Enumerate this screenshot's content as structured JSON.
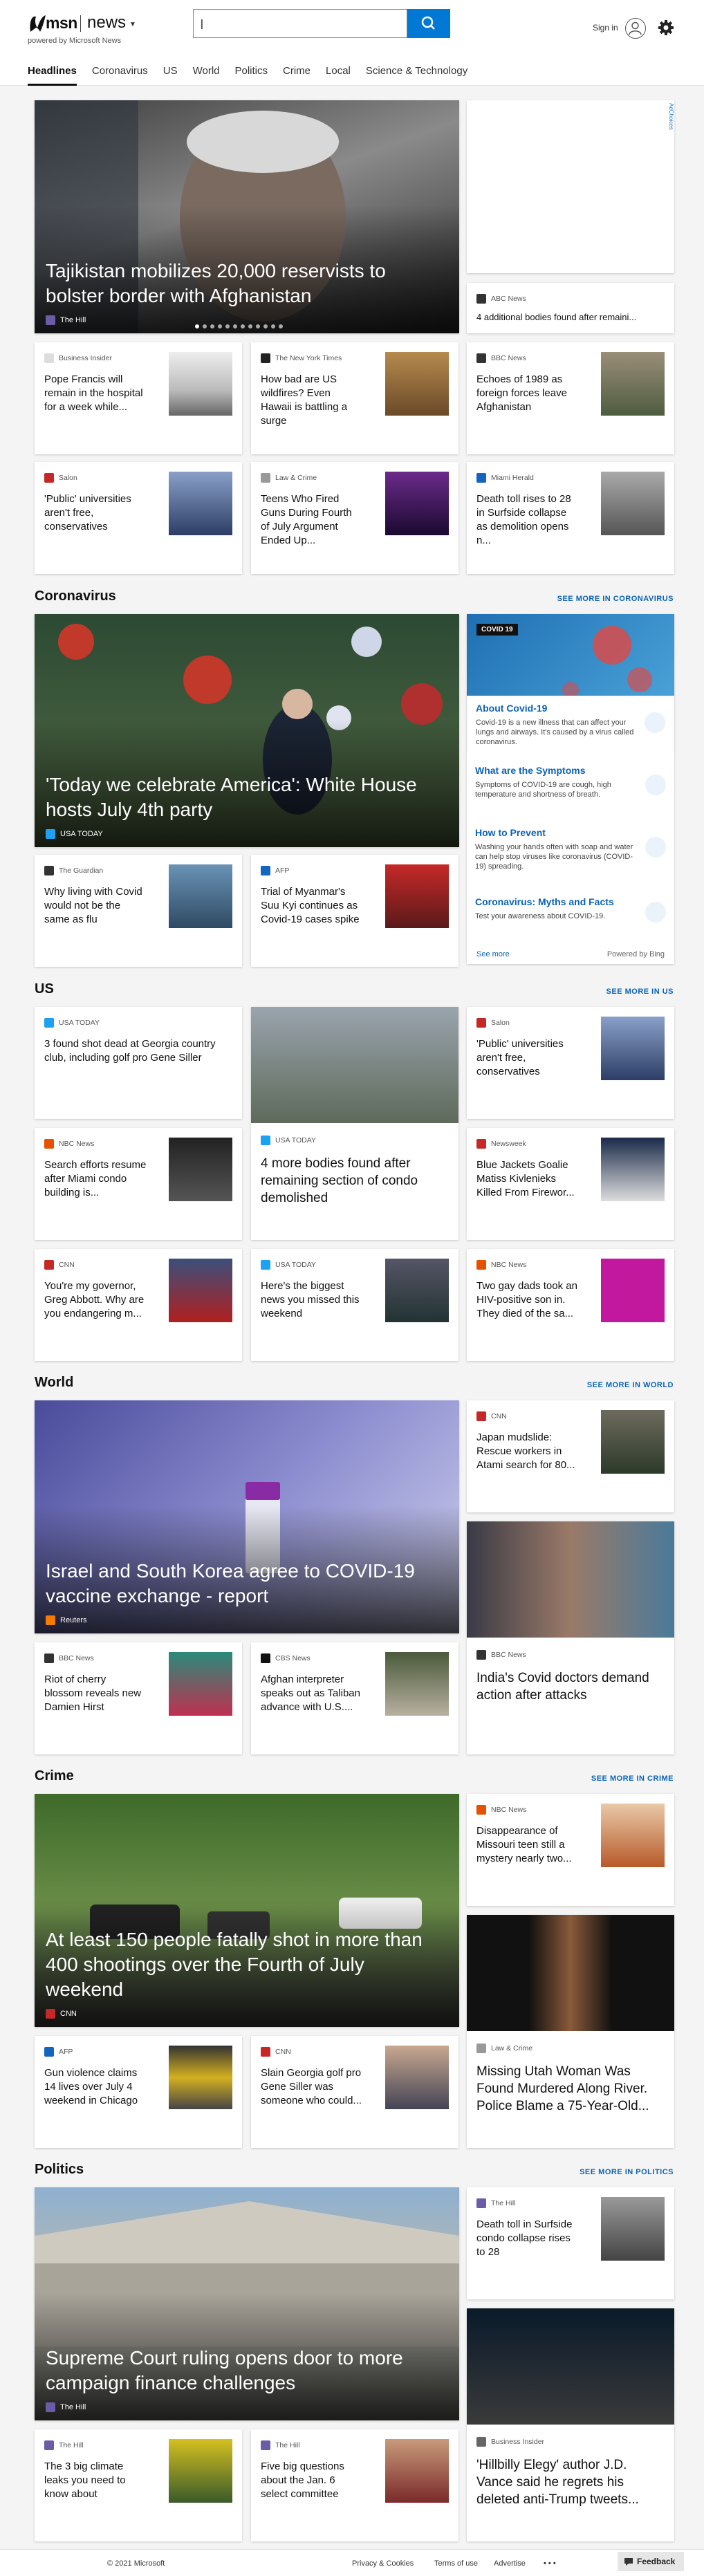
{
  "header": {
    "brand": "msn",
    "section": "news",
    "powered_by": "powered by Microsoft News",
    "search_value": "|",
    "signin": "Sign in"
  },
  "nav": [
    "Headlines",
    "Coronavirus",
    "US",
    "World",
    "Politics",
    "Crime",
    "Local",
    "Science & Technology"
  ],
  "headlines": {
    "hero": {
      "title": "Tajikistan mobilizes 20,000 reservists to bolster border with Afghanistan",
      "source": "The Hill"
    },
    "side": {
      "source": "ABC News",
      "title": "4 additional bodies found after remaini..."
    },
    "cards": [
      {
        "source": "Business Insider",
        "title": "Pope Francis will remain in the hospital for a week while..."
      },
      {
        "source": "The New York Times",
        "title": "How bad are US wildfires? Even Hawaii is battling a surge"
      },
      {
        "source": "BBC News",
        "title": "Echoes of 1989 as foreign forces leave Afghanistan"
      },
      {
        "source": "Salon",
        "title": "'Public' universities aren't free, conservatives"
      },
      {
        "source": "Law & Crime",
        "title": "Teens Who Fired Guns During Fourth of July Argument Ended Up..."
      },
      {
        "source": "Miami Herald",
        "title": "Death toll rises to 28 in Surfside collapse as demolition opens n..."
      }
    ]
  },
  "coronavirus": {
    "title": "Coronavirus",
    "see_more": "SEE MORE IN CORONAVIRUS",
    "hero": {
      "title": "'Today we celebrate America': White House hosts July 4th party",
      "source": "USA TODAY"
    },
    "cards": [
      {
        "source": "The Guardian",
        "title": "Why living with Covid would not be the same as flu"
      },
      {
        "source": "AFP",
        "title": "Trial of Myanmar's Suu Kyi continues as Covid-19 cases spike"
      }
    ],
    "widget": {
      "badge": "COVID 19",
      "items": [
        {
          "title": "About Covid-19",
          "desc": "Covid-19 is a new illness that can affect your lungs and airways. It's caused by a virus called coronavirus."
        },
        {
          "title": "What are the Symptoms",
          "desc": "Symptoms of COVID-19 are cough, high temperature and shortness of breath."
        },
        {
          "title": "How to Prevent",
          "desc": "Washing your hands often with soap and water can help stop viruses like coronavirus (COVID-19) spreading."
        },
        {
          "title": "Coronavirus: Myths and Facts",
          "desc": "Test your awareness about COVID-19."
        }
      ],
      "see_more": "See more",
      "powered": "Powered by Bing"
    }
  },
  "us": {
    "title": "US",
    "see_more": "SEE MORE IN US",
    "cards": [
      {
        "source": "USA TODAY",
        "title": "3 found shot dead at Georgia country club, including golf pro Gene Siller"
      },
      {
        "source": "Salon",
        "title": "'Public' universities aren't free, conservatives"
      },
      {
        "source": "NBC News",
        "title": "Search efforts resume after Miami condo building is..."
      },
      {
        "source": "Newsweek",
        "title": "Blue Jackets Goalie Matiss Kivlenieks Killed From Firewor..."
      },
      {
        "source": "CNN",
        "title": "You're my governor, Greg Abbott. Why are you endangering m..."
      },
      {
        "source": "USA TODAY",
        "title": "Here's the biggest news you missed this weekend"
      },
      {
        "source": "NBC News",
        "title": "Two gay dads took an HIV-positive son in. They died of the sa..."
      }
    ],
    "big": {
      "source": "USA TODAY",
      "title": "4 more bodies found after remaining section of condo demolished"
    }
  },
  "world": {
    "title": "World",
    "see_more": "SEE MORE IN WORLD",
    "hero": {
      "title": "Israel and South Korea agree to COVID-19 vaccine exchange - report",
      "source": "Reuters"
    },
    "cards": [
      {
        "source": "CNN",
        "title": "Japan mudslide: Rescue workers in Atami search for 80..."
      },
      {
        "source": "BBC News",
        "title": "Riot of cherry blossom reveals new Damien Hirst"
      },
      {
        "source": "CBS News",
        "title": "Afghan interpreter speaks out as Taliban advance with U.S...."
      }
    ],
    "big": {
      "source": "BBC News",
      "title": "India's Covid doctors demand action after attacks"
    }
  },
  "crime": {
    "title": "Crime",
    "see_more": "SEE MORE IN CRIME",
    "hero": {
      "title": "At least 150 people fatally shot in more than 400 shootings over the Fourth of July weekend",
      "source": "CNN"
    },
    "cards": [
      {
        "source": "NBC News",
        "title": "Disappearance of Missouri teen still a mystery nearly two..."
      },
      {
        "source": "AFP",
        "title": "Gun violence claims 14 lives over July 4 weekend in Chicago"
      },
      {
        "source": "CNN",
        "title": "Slain Georgia golf pro Gene Siller was someone who could..."
      }
    ],
    "big": {
      "source": "Law & Crime",
      "title": "Missing Utah Woman Was Found Murdered Along River. Police Blame a 75-Year-Old..."
    }
  },
  "politics": {
    "title": "Politics",
    "see_more": "SEE MORE IN POLITICS",
    "hero": {
      "title": "Supreme Court ruling opens door to more campaign finance challenges",
      "source": "The Hill"
    },
    "cards": [
      {
        "source": "The Hill",
        "title": "Death toll in Surfside condo collapse rises to 28"
      },
      {
        "source": "The Hill",
        "title": "The 3 big climate leaks you need to know about"
      },
      {
        "source": "The Hill",
        "title": "Five big questions about the Jan. 6 select committee"
      }
    ],
    "big": {
      "source": "Business Insider",
      "title": "'Hillbilly Elegy' author J.D. Vance said he regrets his deleted anti-Trump tweets..."
    }
  },
  "ad": {
    "label": "AdChoices"
  },
  "footer": {
    "copyright": "© 2021 Microsoft",
    "links": [
      "Privacy & Cookies",
      "Terms of use",
      "Advertise"
    ],
    "more": "• • •",
    "feedback": "Feedback"
  }
}
